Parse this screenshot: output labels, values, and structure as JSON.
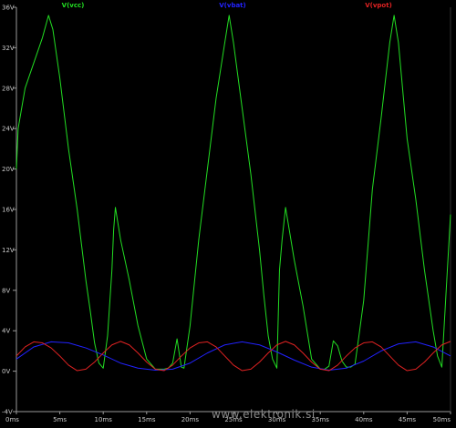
{
  "chart_data": {
    "type": "line",
    "title": "",
    "xlabel": "",
    "ylabel": "",
    "xlim": [
      0,
      50
    ],
    "ylim": [
      -4,
      36
    ],
    "grid": false,
    "background": "#000000",
    "axis_color": "#9a9a9a",
    "y_ticks": [
      {
        "value": 36,
        "label": "36V"
      },
      {
        "value": 32,
        "label": "32V"
      },
      {
        "value": 28,
        "label": "28V"
      },
      {
        "value": 24,
        "label": "24V"
      },
      {
        "value": 20,
        "label": "20V"
      },
      {
        "value": 16,
        "label": "16V"
      },
      {
        "value": 12,
        "label": "12V"
      },
      {
        "value": 8,
        "label": "8V"
      },
      {
        "value": 4,
        "label": "4V"
      },
      {
        "value": 0,
        "label": "0V"
      },
      {
        "value": -4,
        "label": "-4V"
      }
    ],
    "x_ticks": [
      {
        "value": 0,
        "label": "0ms"
      },
      {
        "value": 5,
        "label": "5ms"
      },
      {
        "value": 10,
        "label": "10ms"
      },
      {
        "value": 15,
        "label": "15ms"
      },
      {
        "value": 20,
        "label": "20ms"
      },
      {
        "value": 25,
        "label": "25ms"
      },
      {
        "value": 30,
        "label": "30ms"
      },
      {
        "value": 35,
        "label": "35ms"
      },
      {
        "value": 40,
        "label": "40ms"
      },
      {
        "value": 45,
        "label": "45ms"
      },
      {
        "value": 50,
        "label": "50ms"
      }
    ],
    "series": [
      {
        "name": "V(vcc)",
        "color": "#22dd22",
        "x": [
          0,
          0.2,
          1,
          2,
          3,
          3.7,
          4.2,
          5,
          6,
          7,
          8,
          8.5,
          9,
          9.5,
          10,
          10.5,
          11,
          11.2,
          11.4,
          12,
          13,
          14,
          15,
          16,
          17,
          17.5,
          18,
          18.5,
          18.8,
          19,
          19.3,
          20,
          21,
          22,
          23,
          24,
          24.5,
          25,
          26,
          27,
          28,
          28.5,
          29,
          29.5,
          30,
          30.3,
          30.6,
          31,
          32,
          33,
          34,
          35,
          35.5,
          36,
          36.5,
          37,
          37.5,
          38,
          38.5,
          39,
          39.5,
          40,
          41,
          42,
          43,
          43.5,
          44,
          45,
          46,
          47,
          48,
          48.5,
          49,
          49.5,
          50
        ],
        "y": [
          20,
          24,
          28,
          30.5,
          33,
          35.2,
          33.8,
          29,
          22,
          16,
          9,
          6,
          2.8,
          0.8,
          0.3,
          3.5,
          10,
          14,
          16.2,
          13,
          9,
          4.5,
          1.2,
          0.2,
          0.2,
          0.3,
          0.8,
          3.2,
          1.5,
          0.4,
          0.3,
          4.5,
          13,
          20,
          27,
          32.5,
          35.2,
          32.5,
          26,
          19.5,
          12,
          7.5,
          3.5,
          1.2,
          0.3,
          10,
          13,
          16.2,
          11,
          6.5,
          1.2,
          0.2,
          0.2,
          0.5,
          3,
          2.5,
          1,
          0.4,
          0.4,
          0.7,
          3.8,
          7,
          18,
          25,
          32.5,
          35.2,
          32.5,
          23,
          17,
          10,
          4,
          1.5,
          0.4,
          8,
          15.5
        ]
      },
      {
        "name": "V(vbat)",
        "color": "#2222ff",
        "x": [
          0,
          2,
          4,
          6,
          8,
          10,
          12,
          14,
          16,
          18,
          20,
          22,
          24,
          26,
          28,
          30,
          32,
          34,
          36,
          38,
          40,
          42,
          44,
          46,
          48,
          50
        ],
        "y": [
          1.2,
          2.4,
          2.9,
          2.8,
          2.3,
          1.6,
          0.8,
          0.3,
          0.1,
          0.2,
          0.8,
          1.8,
          2.6,
          2.9,
          2.6,
          1.9,
          1.1,
          0.4,
          0.1,
          0.3,
          1.0,
          2.0,
          2.7,
          2.9,
          2.4,
          1.5
        ]
      },
      {
        "name": "V(vpot)",
        "color": "#e02222",
        "x": [
          0,
          1,
          2,
          3,
          4,
          5,
          6,
          7,
          8,
          9,
          10,
          11,
          12,
          13,
          14,
          15,
          16,
          17,
          18,
          19,
          20,
          21,
          22,
          23,
          24,
          25,
          26,
          27,
          28,
          29,
          30,
          31,
          32,
          33,
          34,
          35,
          36,
          37,
          38,
          39,
          40,
          41,
          42,
          43,
          44,
          45,
          46,
          47,
          48,
          49,
          50
        ],
        "y": [
          1.5,
          2.4,
          2.9,
          2.8,
          2.3,
          1.5,
          0.6,
          0.05,
          0.2,
          0.9,
          1.8,
          2.6,
          2.95,
          2.6,
          1.8,
          0.9,
          0.2,
          0.05,
          0.6,
          1.5,
          2.3,
          2.8,
          2.9,
          2.4,
          1.5,
          0.6,
          0.05,
          0.2,
          0.9,
          1.8,
          2.6,
          2.95,
          2.6,
          1.8,
          0.9,
          0.2,
          0.05,
          0.6,
          1.5,
          2.3,
          2.8,
          2.9,
          2.4,
          1.5,
          0.6,
          0.05,
          0.2,
          0.9,
          1.8,
          2.6,
          2.95
        ]
      }
    ],
    "watermark": "www.elektronik.si"
  }
}
